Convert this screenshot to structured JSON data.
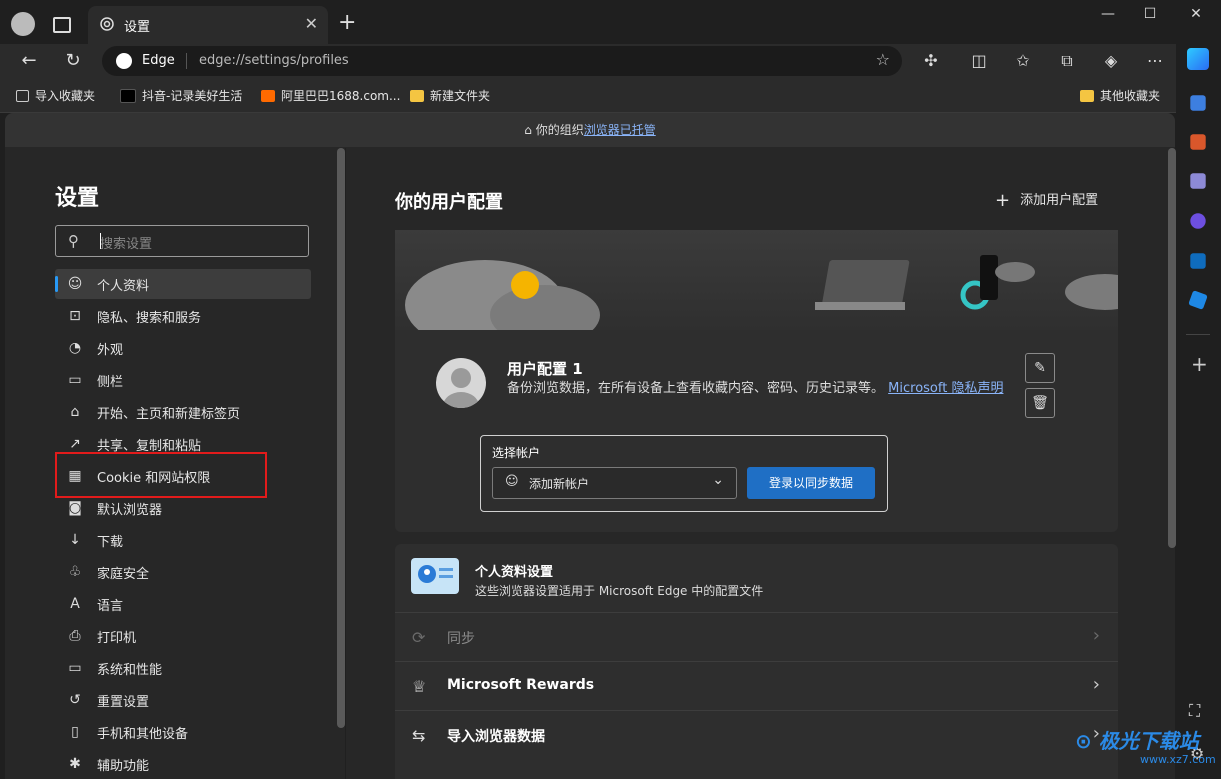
{
  "tab": {
    "title": "设置",
    "close": "✕"
  },
  "window": {
    "minimize": "—",
    "maximize": "☐",
    "close": "✕",
    "new_tab": "+"
  },
  "address": {
    "brand": "Edge",
    "url": "edge://settings/profiles"
  },
  "bookmarks": [
    {
      "label": "导入收藏夹"
    },
    {
      "label": "抖音-记录美好生活"
    },
    {
      "label": "阿里巴巴1688.com..."
    },
    {
      "label": "新建文件夹"
    }
  ],
  "bookmarks_other": "其他收藏夹",
  "managed": {
    "prefix": "你的组织",
    "link": "浏览器已托管"
  },
  "sidebar": {
    "title": "设置",
    "search_placeholder": "搜索设置",
    "items": [
      {
        "label": "个人资料",
        "icon": "profile-icon",
        "glyph": "☺"
      },
      {
        "label": "隐私、搜索和服务",
        "icon": "lock-icon",
        "glyph": "⊡"
      },
      {
        "label": "外观",
        "icon": "palette-icon",
        "glyph": "◔"
      },
      {
        "label": "侧栏",
        "icon": "sidebar-icon",
        "glyph": "▭"
      },
      {
        "label": "开始、主页和新建标签页",
        "icon": "home-icon",
        "glyph": "⌂"
      },
      {
        "label": "共享、复制和粘贴",
        "icon": "share-icon",
        "glyph": "↗"
      },
      {
        "label": "Cookie 和网站权限",
        "icon": "cookie-icon",
        "glyph": "▦"
      },
      {
        "label": "默认浏览器",
        "icon": "browser-icon",
        "glyph": "◙"
      },
      {
        "label": "下载",
        "icon": "download-icon",
        "glyph": "↓"
      },
      {
        "label": "家庭安全",
        "icon": "family-icon",
        "glyph": "♧"
      },
      {
        "label": "语言",
        "icon": "language-icon",
        "glyph": "A"
      },
      {
        "label": "打印机",
        "icon": "printer-icon",
        "glyph": "⎙"
      },
      {
        "label": "系统和性能",
        "icon": "laptop-icon",
        "glyph": "▭"
      },
      {
        "label": "重置设置",
        "icon": "reset-icon",
        "glyph": "↺"
      },
      {
        "label": "手机和其他设备",
        "icon": "phone-icon",
        "glyph": "▯"
      },
      {
        "label": "辅助功能",
        "icon": "accessibility-icon",
        "glyph": "✱"
      }
    ]
  },
  "main": {
    "title": "你的用户配置",
    "add_profile": "添加用户配置",
    "profile_name": "用户配置 1",
    "profile_desc": "备份浏览数据，在所有设备上查看收藏内容、密码、历史记录等。",
    "privacy_link": "Microsoft 隐私声明",
    "account_title": "选择帐户",
    "account_value": "添加新帐户",
    "signin_button": "登录以同步数据",
    "profile_settings_title": "个人资料设置",
    "profile_settings_desc": "这些浏览器设置适用于 Microsoft Edge 中的配置文件",
    "rows": [
      {
        "label": "同步",
        "icon": "sync-icon",
        "glyph": "⟳",
        "dim": true
      },
      {
        "label": "Microsoft Rewards",
        "icon": "trophy-icon",
        "glyph": "♕",
        "dim": false
      },
      {
        "label": "导入浏览器数据",
        "icon": "import-icon",
        "glyph": "⇆",
        "dim": false
      }
    ]
  },
  "watermark": {
    "text": "极光下载站",
    "sub": "www.xz7.com"
  },
  "colors": {
    "accent": "#2899f5",
    "button": "#1f6fc5",
    "highlight": "#e21b1b"
  }
}
